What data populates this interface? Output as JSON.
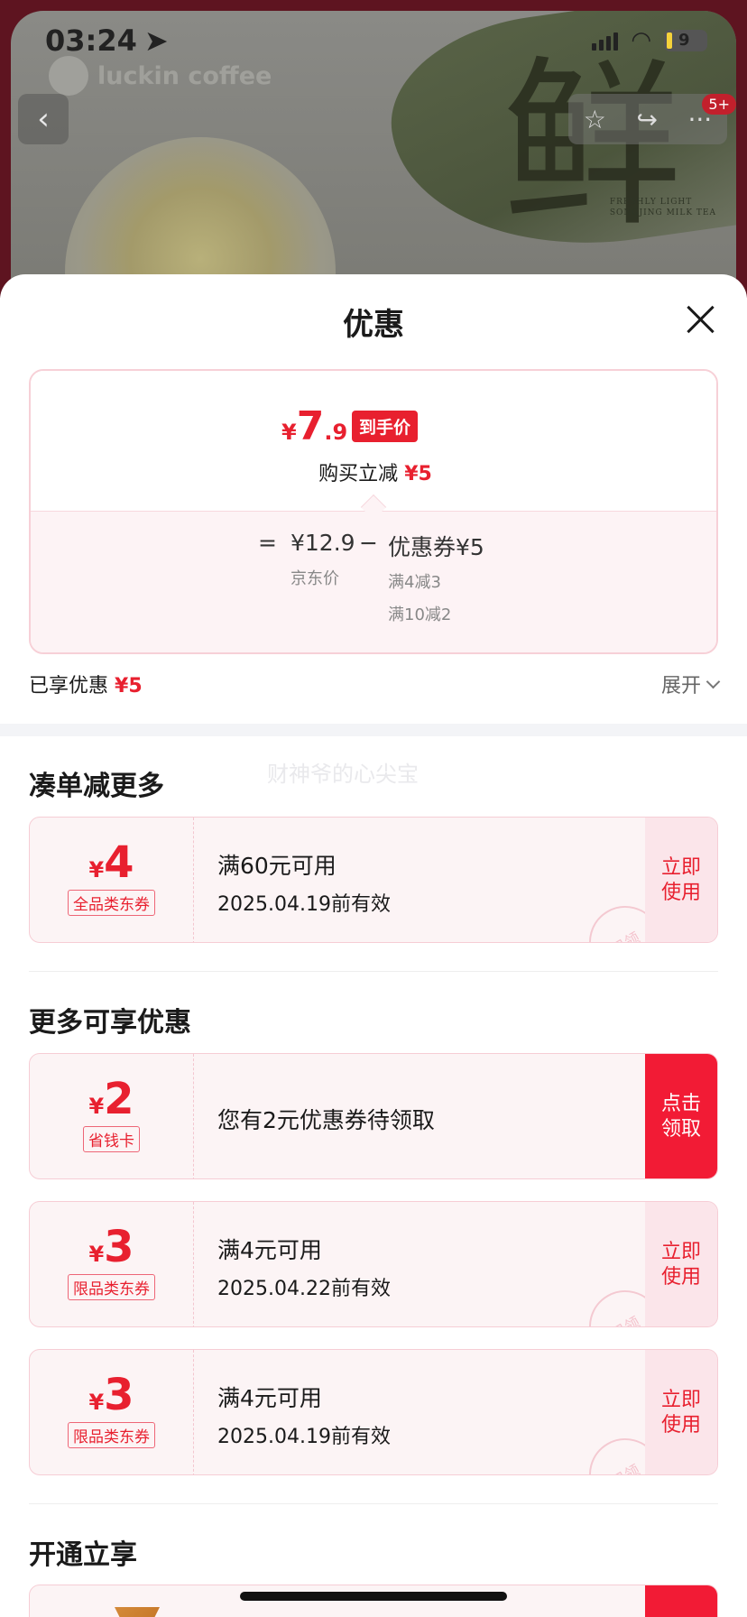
{
  "status_bar": {
    "time": "03:24",
    "battery": "9"
  },
  "hero": {
    "brand": "luckin coffee",
    "calligraphy": "鲜",
    "small_text_1": "FRESHLY LIGHT",
    "small_text_2": "SONGJING MILK TEA",
    "badge": "5+"
  },
  "sheet": {
    "title": "优惠"
  },
  "price": {
    "currency": "¥",
    "final_int": "7",
    "final_dec": ".9",
    "final_tag": "到手价",
    "buy_label": "购买立减",
    "buy_amount": "¥5",
    "formula_eq": "=",
    "formula_original": "¥12.9",
    "formula_minus": "−",
    "formula_coupon": "优惠券¥5",
    "original_label": "京东价",
    "rule_1": "满4减3",
    "rule_2": "满10减2"
  },
  "enjoyed": {
    "label": "已享优惠",
    "amount": "¥5",
    "expand": "展开"
  },
  "watermark": "财神爷的心尖宝",
  "sections": {
    "more": "凑单减更多",
    "more_offers": "更多可享优惠",
    "open": "开通立享"
  },
  "coupons": [
    {
      "currency": "¥",
      "amount": "4",
      "type": "全品类东券",
      "line1": "满60元可用",
      "line2": "2025.04.19前有效",
      "button": "立即使用",
      "stamp": "已领"
    },
    {
      "currency": "¥",
      "amount": "2",
      "type": "省钱卡",
      "line1": "您有2元优惠券待领取",
      "button": "点击领取"
    },
    {
      "currency": "¥",
      "amount": "3",
      "type": "限品类东券",
      "line1": "满4元可用",
      "line2": "2025.04.22前有效",
      "button": "立即使用",
      "stamp": "已领"
    },
    {
      "currency": "¥",
      "amount": "3",
      "type": "限品类东券",
      "line1": "满4元可用",
      "line2": "2025.04.19前有效",
      "button": "立即使用",
      "stamp": "已领"
    }
  ],
  "colors": {
    "accent": "#e8202f",
    "accent_button": "#f21b35",
    "coupon_bg": "#fcf4f5",
    "border": "#f6cdd5"
  }
}
